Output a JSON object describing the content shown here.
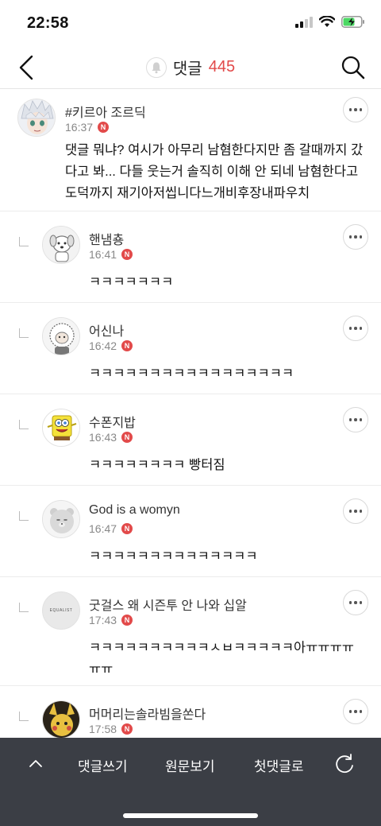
{
  "status": {
    "time": "22:58"
  },
  "header": {
    "title": "댓글",
    "count": "445"
  },
  "comments": [
    {
      "author": "#키르아 조르딕",
      "time": "16:37",
      "badge": "N",
      "text": "댓글 뭐냐? 여시가 아무리 남혐한다지만 좀 갈때까지 갔다고 봐... 다들 웃는거 솔직히 이해 안 되네 남혐한다고 도덕까지 재기아저씹니다느개비후장내파우치"
    },
    {
      "author": "핸냄춍",
      "time": "16:41",
      "badge": "N",
      "text": "ㅋㅋㅋㅋㅋㅋㅋ"
    },
    {
      "author": "어신나",
      "time": "16:42",
      "badge": "N",
      "text": "ㅋㅋㅋㅋㅋㅋㅋㅋㅋㅋㅋㅋㅋㅋㅋㅋㅋ"
    },
    {
      "author": "수폰지밥",
      "time": "16:43",
      "badge": "N",
      "text": "ㅋㅋㅋㅋㅋㅋㅋㅋ 빵터짐"
    },
    {
      "author": "God is a womyn",
      "time": "16:47",
      "badge": "N",
      "text": "ㅋㅋㅋㅋㅋㅋㅋㅋㅋㅋㅋㅋㅋㅋ"
    },
    {
      "author": "굿걸스 왜 시즌투 안 나와 십알",
      "time": "17:43",
      "badge": "N",
      "text": "ㅋㅋㅋㅋㅋㅋㅋㅋㅋㅋㅅㅂㅋㅋㅋㅋㅋ아ㅠㅠㅠㅠㅠㅠ",
      "avatar_text": "EQUALIST"
    },
    {
      "author": "머머리는솔라빔을쏜다",
      "time": "17:58",
      "badge": "N",
      "text": ""
    }
  ],
  "toolbar": {
    "write": "댓글쓰기",
    "original": "원문보기",
    "first": "첫댓글로"
  },
  "colors": {
    "accent": "#e24a4a",
    "toolbar_bg": "#3b3e45"
  }
}
